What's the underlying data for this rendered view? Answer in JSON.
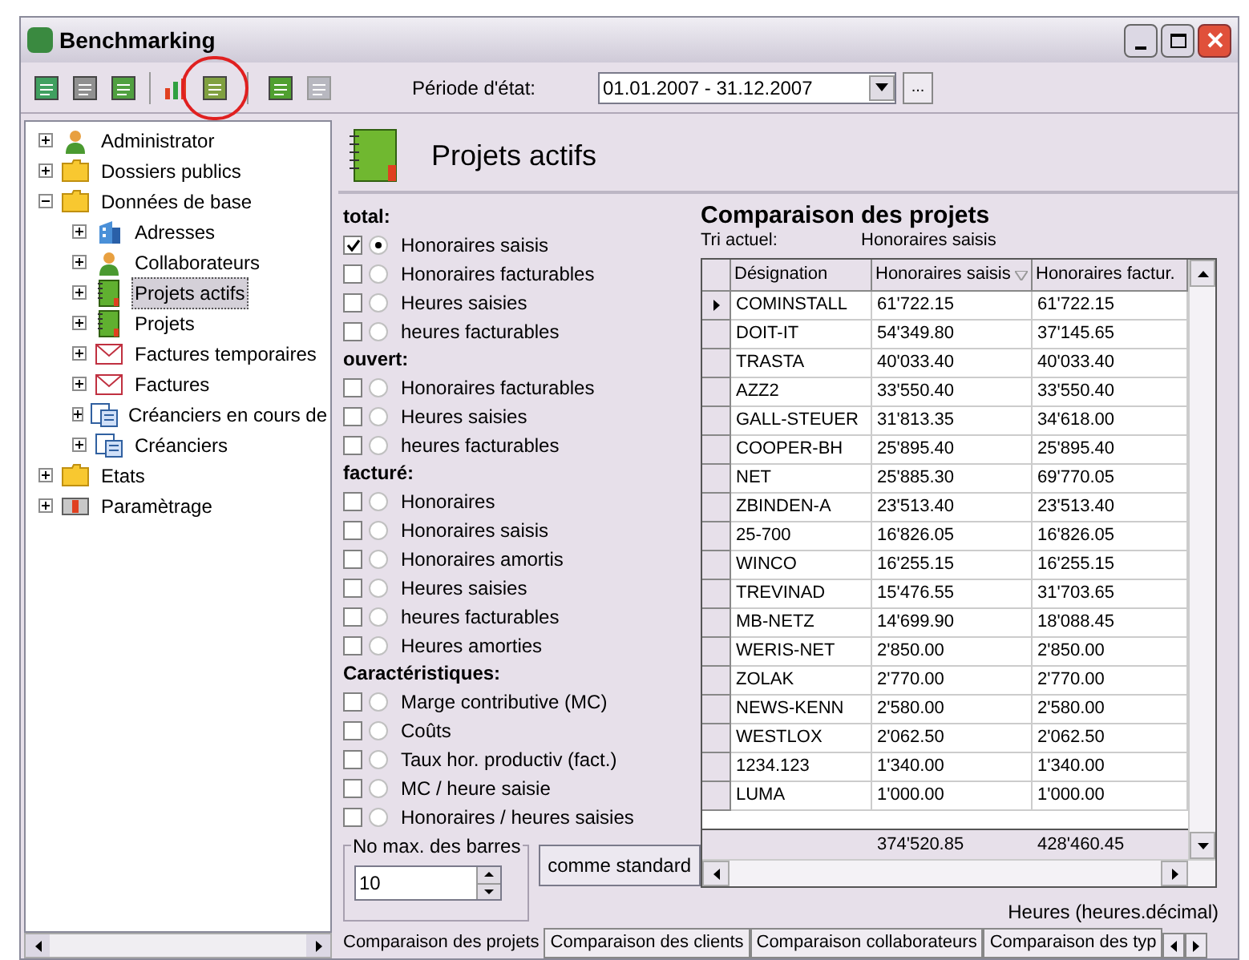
{
  "window": {
    "title": "Benchmarking"
  },
  "toolbar": {
    "period_label": "Période d'état:",
    "period_value": "01.01.2007 - 31.12.2007",
    "browse_label": "..."
  },
  "tree": [
    {
      "label": "Administrator",
      "kind": "person",
      "expanded": false,
      "selected": false
    },
    {
      "label": "Dossiers publics",
      "kind": "folder",
      "expanded": false,
      "selected": false
    },
    {
      "label": "Données de base",
      "kind": "folder",
      "expanded": true,
      "selected": false,
      "children": [
        {
          "label": "Adresses",
          "kind": "building",
          "expanded": false,
          "selected": false
        },
        {
          "label": "Collaborateurs",
          "kind": "person",
          "expanded": false,
          "selected": false
        },
        {
          "label": "Projets actifs",
          "kind": "notebook",
          "expanded": false,
          "selected": true
        },
        {
          "label": "Projets",
          "kind": "notebook",
          "expanded": false,
          "selected": false
        },
        {
          "label": "Factures temporaires",
          "kind": "envelope",
          "expanded": false,
          "selected": false
        },
        {
          "label": "Factures",
          "kind": "envelope",
          "expanded": false,
          "selected": false
        },
        {
          "label": "Créanciers en cours de",
          "kind": "card",
          "expanded": false,
          "selected": false
        },
        {
          "label": "Créanciers",
          "kind": "card",
          "expanded": false,
          "selected": false
        }
      ]
    },
    {
      "label": "Etats",
      "kind": "folder",
      "expanded": false,
      "selected": false
    },
    {
      "label": "Paramètrage",
      "kind": "settings",
      "expanded": false,
      "selected": false
    }
  ],
  "panel": {
    "title": "Projets actifs"
  },
  "options": [
    {
      "title": "total:",
      "items": [
        {
          "label": "Honoraires saisis",
          "checked": true,
          "selected": true
        },
        {
          "label": "Honoraires facturables",
          "checked": false,
          "selected": false
        },
        {
          "label": "Heures saisies",
          "checked": false,
          "selected": false
        },
        {
          "label": "heures facturables",
          "checked": false,
          "selected": false
        }
      ]
    },
    {
      "title": "ouvert:",
      "items": [
        {
          "label": "Honoraires facturables",
          "checked": false,
          "selected": false
        },
        {
          "label": "Heures saisies",
          "checked": false,
          "selected": false
        },
        {
          "label": "heures facturables",
          "checked": false,
          "selected": false
        }
      ]
    },
    {
      "title": "facturé:",
      "items": [
        {
          "label": "Honoraires",
          "checked": false,
          "selected": false
        },
        {
          "label": "Honoraires saisis",
          "checked": false,
          "selected": false
        },
        {
          "label": "Honoraires amortis",
          "checked": false,
          "selected": false
        },
        {
          "label": "Heures saisies",
          "checked": false,
          "selected": false
        },
        {
          "label": "heures facturables",
          "checked": false,
          "selected": false
        },
        {
          "label": "Heures amorties",
          "checked": false,
          "selected": false
        }
      ]
    },
    {
      "title": "Caractéristiques:",
      "items": [
        {
          "label": "Marge contributive (MC)",
          "checked": false,
          "selected": false
        },
        {
          "label": "Coûts",
          "checked": false,
          "selected": false
        },
        {
          "label": "Taux hor. productiv (fact.)",
          "checked": false,
          "selected": false
        },
        {
          "label": "MC / heure saisie",
          "checked": false,
          "selected": false
        },
        {
          "label": "Honoraires / heures saisies",
          "checked": false,
          "selected": false
        }
      ]
    }
  ],
  "max_bars": {
    "label": "No max. des barres",
    "value": "10"
  },
  "standard_button": "comme standard",
  "comparison": {
    "title": "Comparaison des projets",
    "sort_label": "Tri actuel:",
    "sort_value": "Honoraires saisis"
  },
  "table": {
    "columns": [
      "Désignation",
      "Honoraires saisis",
      "Honoraires factur."
    ],
    "rows": [
      {
        "cells": [
          "COMINSTALL",
          "61'722.15",
          "61'722.15"
        ],
        "selected": true
      },
      {
        "cells": [
          "DOIT-IT",
          "54'349.80",
          "37'145.65"
        ],
        "selected": false
      },
      {
        "cells": [
          "TRASTA",
          "40'033.40",
          "40'033.40"
        ],
        "selected": false
      },
      {
        "cells": [
          "AZZ2",
          "33'550.40",
          "33'550.40"
        ],
        "selected": false
      },
      {
        "cells": [
          "GALL-STEUER",
          "31'813.35",
          "34'618.00"
        ],
        "selected": false
      },
      {
        "cells": [
          "COOPER-BH",
          "25'895.40",
          "25'895.40"
        ],
        "selected": false
      },
      {
        "cells": [
          "NET",
          "25'885.30",
          "69'770.05"
        ],
        "selected": false
      },
      {
        "cells": [
          "ZBINDEN-A",
          "23'513.40",
          "23'513.40"
        ],
        "selected": false
      },
      {
        "cells": [
          "25-700",
          "16'826.05",
          "16'826.05"
        ],
        "selected": false
      },
      {
        "cells": [
          "WINCO",
          "16'255.15",
          "16'255.15"
        ],
        "selected": false
      },
      {
        "cells": [
          "TREVINAD",
          "15'476.55",
          "31'703.65"
        ],
        "selected": false
      },
      {
        "cells": [
          "MB-NETZ",
          "14'699.90",
          "18'088.45"
        ],
        "selected": false
      },
      {
        "cells": [
          "WERIS-NET",
          "2'850.00",
          "2'850.00"
        ],
        "selected": false
      },
      {
        "cells": [
          "ZOLAK",
          "2'770.00",
          "2'770.00"
        ],
        "selected": false
      },
      {
        "cells": [
          "NEWS-KENN",
          "2'580.00",
          "2'580.00"
        ],
        "selected": false
      },
      {
        "cells": [
          "WESTLOX",
          "2'062.50",
          "2'062.50"
        ],
        "selected": false
      },
      {
        "cells": [
          "1234.123",
          "1'340.00",
          "1'340.00"
        ],
        "selected": false
      },
      {
        "cells": [
          "LUMA",
          "1'000.00",
          "1'000.00"
        ],
        "selected": false
      }
    ],
    "totals": [
      "374'520.85",
      "428'460.45"
    ]
  },
  "unit_label": "Heures (heures.décimal)",
  "tabs": [
    {
      "label": "Comparaison des projets",
      "selected": true
    },
    {
      "label": "Comparaison des clients",
      "selected": false
    },
    {
      "label": "Comparaison collaborateurs",
      "selected": false
    },
    {
      "label": "Comparaison des typ",
      "selected": false
    }
  ]
}
